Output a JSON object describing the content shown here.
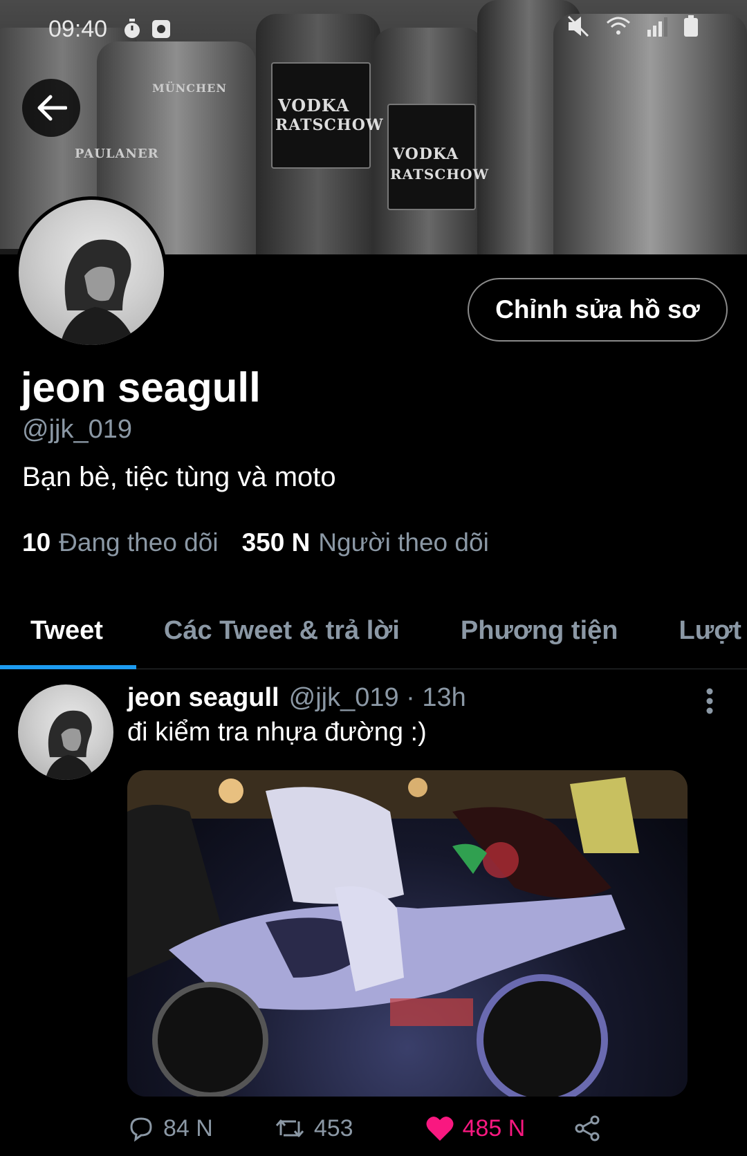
{
  "status_bar": {
    "time": "09:40"
  },
  "profile": {
    "display_name": "jeon seagull",
    "handle": "@jjk_019",
    "bio": "Bạn bè, tiệc tùng và moto",
    "edit_button": "Chỉnh sửa hồ sơ",
    "following_count": "10",
    "following_label": "Đang theo dõi",
    "followers_count": "350 N",
    "followers_label": "Người theo dõi"
  },
  "banner": {
    "bottle_labels": [
      "VODKA",
      "RATSCHOW",
      "VODKA",
      "RATSCHOW",
      "PAULANER",
      "MÜNCHEN"
    ]
  },
  "tabs": [
    {
      "label": "Tweet",
      "active": true
    },
    {
      "label": "Các Tweet & trả lời",
      "active": false
    },
    {
      "label": "Phương tiện",
      "active": false
    },
    {
      "label": "Lượt t",
      "active": false
    }
  ],
  "tweet": {
    "name": "jeon seagull",
    "handle_time": "@jjk_019 · 13h",
    "text": "đi kiểm tra nhựa đường :)",
    "replies": "84 N",
    "retweets": "453",
    "likes": "485 N",
    "like_color": "#f91880"
  },
  "colors": {
    "accent": "#1d9bf0",
    "secondary_text": "#8b98a5",
    "background": "#000000"
  }
}
